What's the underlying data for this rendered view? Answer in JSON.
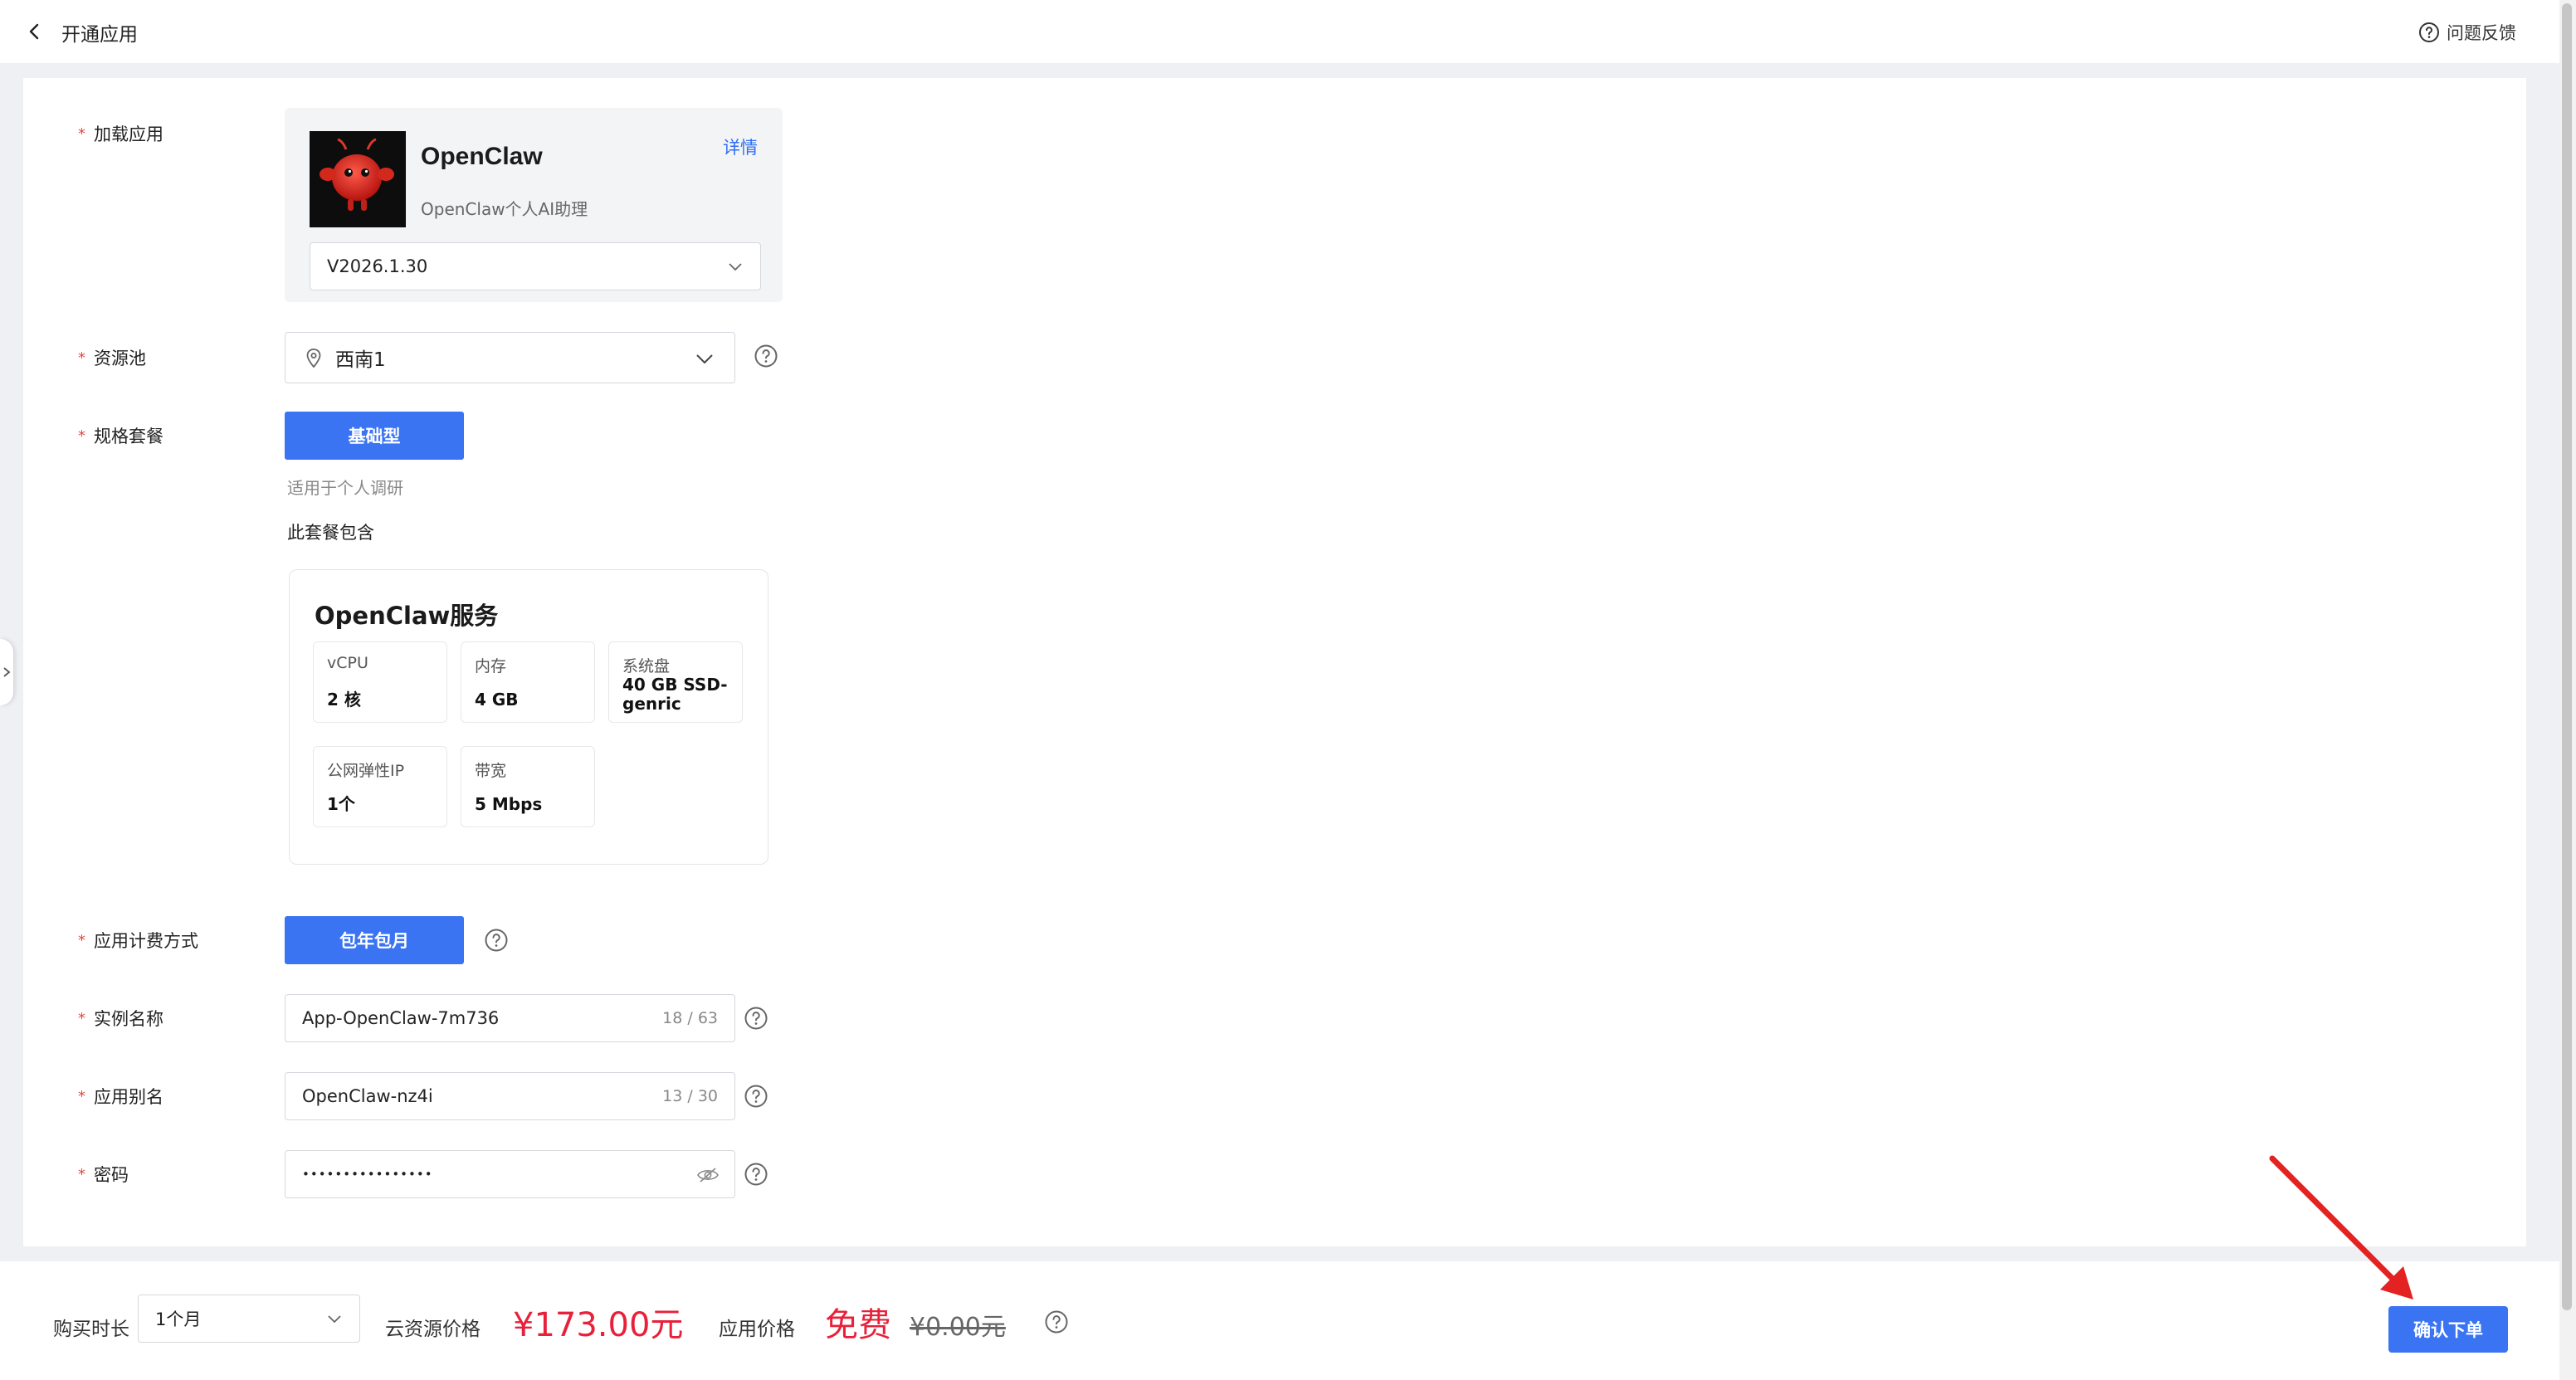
{
  "header": {
    "title": "开通应用",
    "feedback_label": "问题反馈"
  },
  "form": {
    "app": {
      "label": "加载应用",
      "name": "OpenClaw",
      "description": "OpenClaw个人AI助理",
      "detail_link": "详情",
      "version": "V2026.1.30"
    },
    "pool": {
      "label": "资源池",
      "value": "西南1"
    },
    "plan": {
      "label": "规格套餐",
      "selected": "基础型",
      "note": "适用于个人调研",
      "includes_label": "此套餐包含",
      "service_title": "OpenClaw服务",
      "specs": [
        {
          "key": "vCPU",
          "value": "2 核"
        },
        {
          "key": "内存",
          "value": "4 GB"
        },
        {
          "key": "系统盘",
          "value": "40 GB SSD-genric"
        },
        {
          "key": "公网弹性IP",
          "value": "1个"
        },
        {
          "key": "带宽",
          "value": "5 Mbps"
        }
      ]
    },
    "billing": {
      "label": "应用计费方式",
      "selected": "包年包月"
    },
    "instance_name": {
      "label": "实例名称",
      "value": "App-OpenClaw-7m736",
      "count": "18 / 63"
    },
    "alias": {
      "label": "应用别名",
      "value": "OpenClaw-nz4i",
      "count": "13 / 30"
    },
    "password": {
      "label": "密码",
      "value": "••••••••••••••••"
    }
  },
  "bottom": {
    "duration_label": "购买时长",
    "duration_value": "1个月",
    "cloud_price_label": "云资源价格",
    "cloud_price": "¥173.00元",
    "app_price_label": "应用价格",
    "app_price": "免费",
    "app_price_old": "¥0.00元",
    "confirm_label": "确认下单"
  },
  "colors": {
    "primary": "#3a74f2",
    "price": "#e8213a",
    "required": "#e8453c",
    "annotation_arrow": "#e32222"
  }
}
